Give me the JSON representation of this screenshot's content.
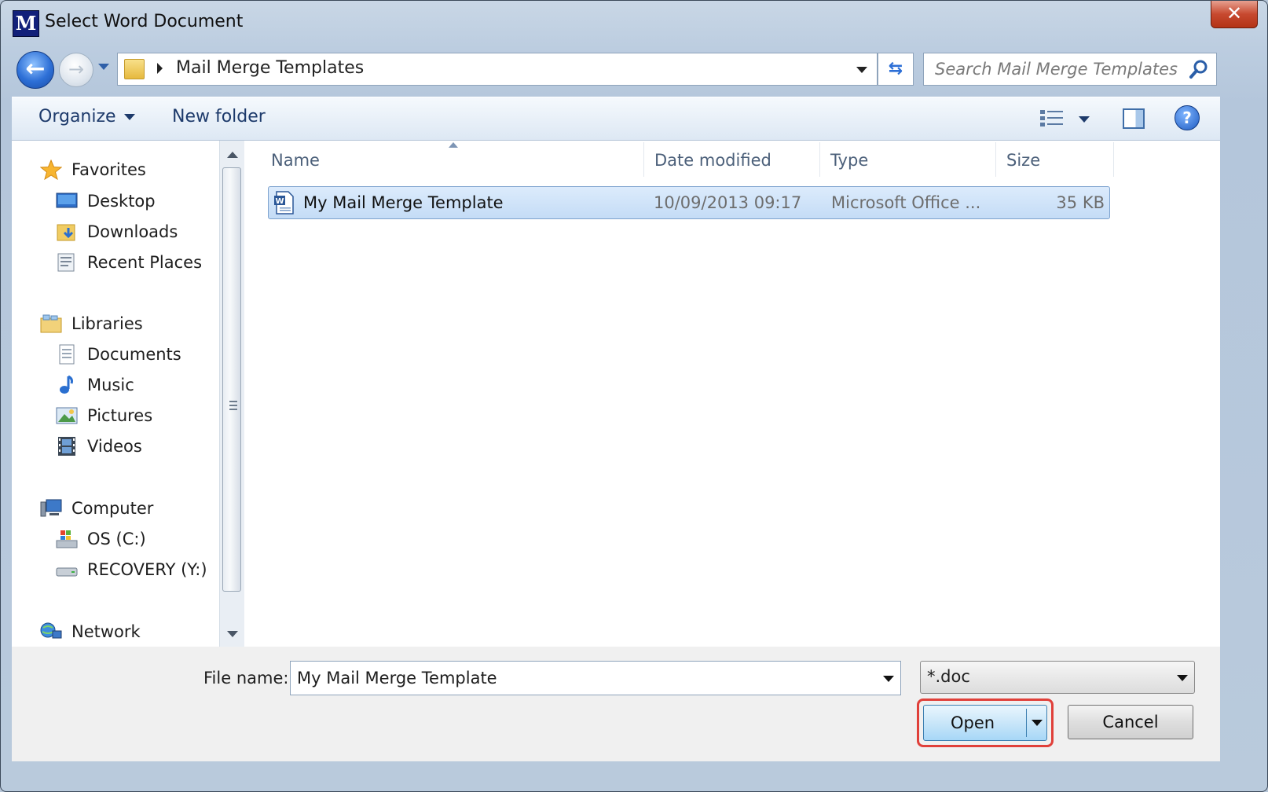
{
  "window": {
    "title": "Select Word Document",
    "app_icon_text": "M",
    "close_symbol": "✕"
  },
  "nav": {
    "back_symbol": "←",
    "forward_symbol": "→",
    "address": "Mail Merge Templates",
    "refresh_symbol": "⇆",
    "search_placeholder": "Search Mail Merge Templates"
  },
  "toolbar": {
    "organize_label": "Organize",
    "new_folder_label": "New folder",
    "help_symbol": "?"
  },
  "sidebar": {
    "favorites": {
      "label": "Favorites",
      "items": [
        "Desktop",
        "Downloads",
        "Recent Places"
      ]
    },
    "libraries": {
      "label": "Libraries",
      "items": [
        "Documents",
        "Music",
        "Pictures",
        "Videos"
      ]
    },
    "computer": {
      "label": "Computer",
      "items": [
        "OS (C:)",
        "RECOVERY (Y:)"
      ]
    },
    "network": {
      "label": "Network"
    }
  },
  "file_list": {
    "columns": [
      "Name",
      "Date modified",
      "Type",
      "Size"
    ],
    "rows": [
      {
        "name": "My Mail Merge Template",
        "date": "10/09/2013 09:17",
        "type": "Microsoft Office ...",
        "size": "35 KB"
      }
    ]
  },
  "footer": {
    "file_name_label": "File name:",
    "file_name_value": "My Mail Merge Template",
    "filter_value": "*.doc",
    "open_label": "Open",
    "cancel_label": "Cancel"
  },
  "colors": {
    "selection": "#c4dcf6",
    "accent": "#2d6fd6",
    "highlight": "#e0403a"
  }
}
